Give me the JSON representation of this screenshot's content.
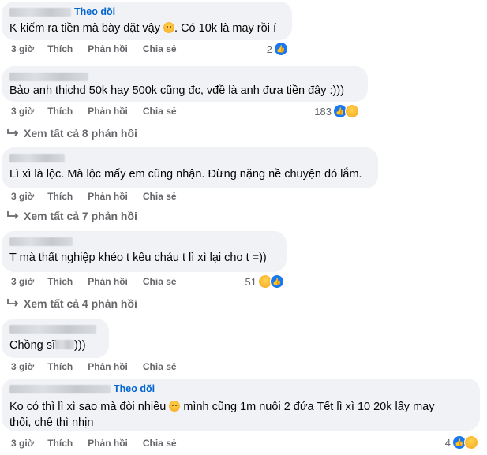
{
  "actions": {
    "time": "3 giờ",
    "like": "Thích",
    "reply": "Phản hồi",
    "share": "Chia sẻ"
  },
  "comments": [
    {
      "follow": "Theo dõi",
      "text": "K kiếm ra tiền mà bày đặt vậy",
      "text_after": ". Có 10k là may rồi í",
      "reaction_count": "2",
      "reactions": [
        "like"
      ]
    },
    {
      "text": "Bảo anh thichd 50k hay 500k cũng đc, vđề là anh đưa tiền đây :)))",
      "reaction_count": "183",
      "reactions": [
        "like",
        "haha"
      ]
    },
    {
      "text": "Lì xì là lộc. Mà lộc mấy em cũng nhận. Đừng nặng nề chuyện đó lắm.",
      "reaction_count": "",
      "reactions": []
    },
    {
      "text": "T mà thất nghiệp khéo t kêu cháu t lì xì lại cho t =))",
      "reaction_count": "51",
      "reactions": [
        "haha",
        "like"
      ]
    },
    {
      "text": "Chồng sĩ",
      "text_after": ")))",
      "reaction_count": "",
      "reactions": []
    },
    {
      "follow": "Theo dõi",
      "text_line1": "Ko có thì lì xì sao mà đòi nhiều",
      "text_line1_after": " mình cũng 1m nuôi 2 đứa Tết lì xì 10 20k lấy may",
      "text_line2": "thôi, chê thì nhịn",
      "reaction_count": "4",
      "reactions": [
        "like",
        "wow"
      ]
    }
  ],
  "view_more": [
    "Xem tất cả 8 phản hồi",
    "Xem tất cả 7 phản hồi",
    "Xem tất cả 4 phản hồi"
  ],
  "icons": {
    "reply_arrow": "reply-arrow-icon",
    "like": "like-icon",
    "haha": "haha-icon",
    "wow": "wow-icon",
    "emoji": "slight-smile-emoji-icon"
  },
  "colors": {
    "bubble": "#f0f2f5",
    "follow": "#0064d1",
    "muted": "#65676b",
    "like": "#1877f2"
  }
}
